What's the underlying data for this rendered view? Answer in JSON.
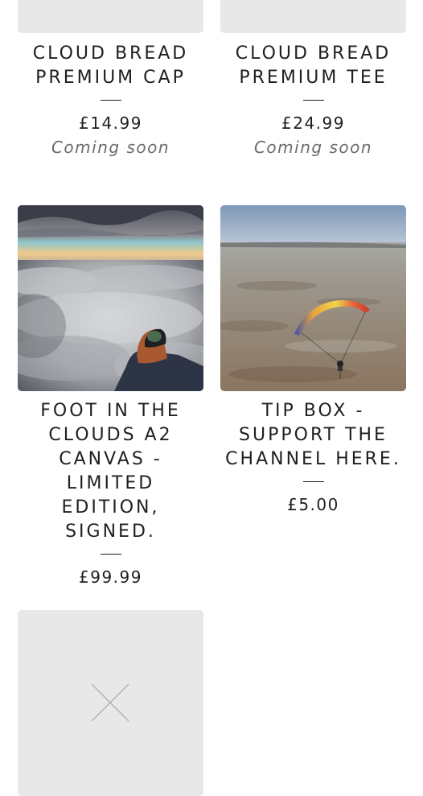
{
  "products": [
    {
      "title": "CLOUD BREAD PREMIUM CAP",
      "price": "£14.99",
      "status": "Coming soon",
      "image": "placeholder"
    },
    {
      "title": "CLOUD BREAD PREMIUM TEE",
      "price": "£24.99",
      "status": "Coming soon",
      "image": "placeholder"
    },
    {
      "title": "FOOT IN THE CLOUDS A2 CANVAS - LIMITED EDITION, SIGNED.",
      "price": "£99.99",
      "image": "photo-foot-above-clouds"
    },
    {
      "title": "TIP BOX - SUPPORT THE CHANNEL HERE.",
      "price": "£5.00",
      "image": "photo-paramotor-over-beach"
    },
    {
      "image": "placeholder-missing-image-icon"
    }
  ],
  "colors": {
    "text": "#1f1f1f",
    "muted": "#6b6b6b",
    "placeholder": "#e8e8e8"
  }
}
